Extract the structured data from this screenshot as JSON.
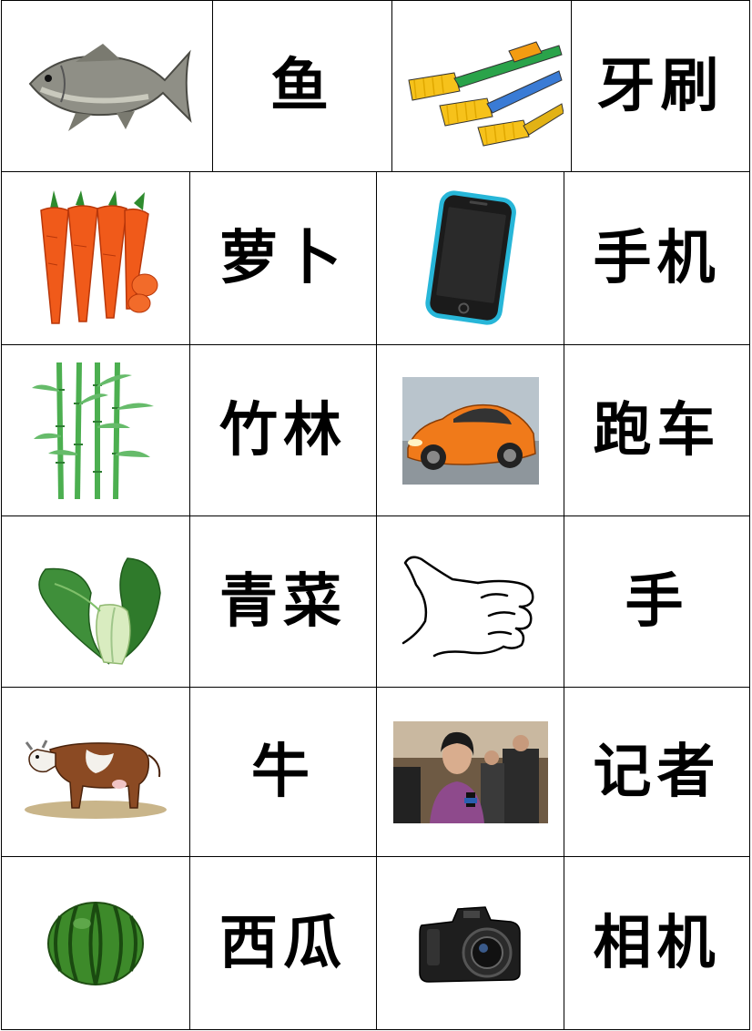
{
  "rows": [
    {
      "picture1": "fish-icon",
      "word1": "鱼",
      "picture2": "toothbrush-icon",
      "word2": "牙刷"
    },
    {
      "picture1": "carrot-icon",
      "word1": "萝卜",
      "picture2": "mobile-phone-icon",
      "word2": "手机"
    },
    {
      "picture1": "bamboo-icon",
      "word1": "竹林",
      "picture2": "sports-car-icon",
      "word2": "跑车"
    },
    {
      "picture1": "bok-choy-icon",
      "word1": "青菜",
      "picture2": "thumbs-up-hand-icon",
      "word2": "手"
    },
    {
      "picture1": "cow-icon",
      "word1": "牛",
      "picture2": "reporter-photo-icon",
      "word2": "记者"
    },
    {
      "picture1": "watermelon-icon",
      "word1": "西瓜",
      "picture2": "camera-icon",
      "word2": "相机"
    }
  ]
}
